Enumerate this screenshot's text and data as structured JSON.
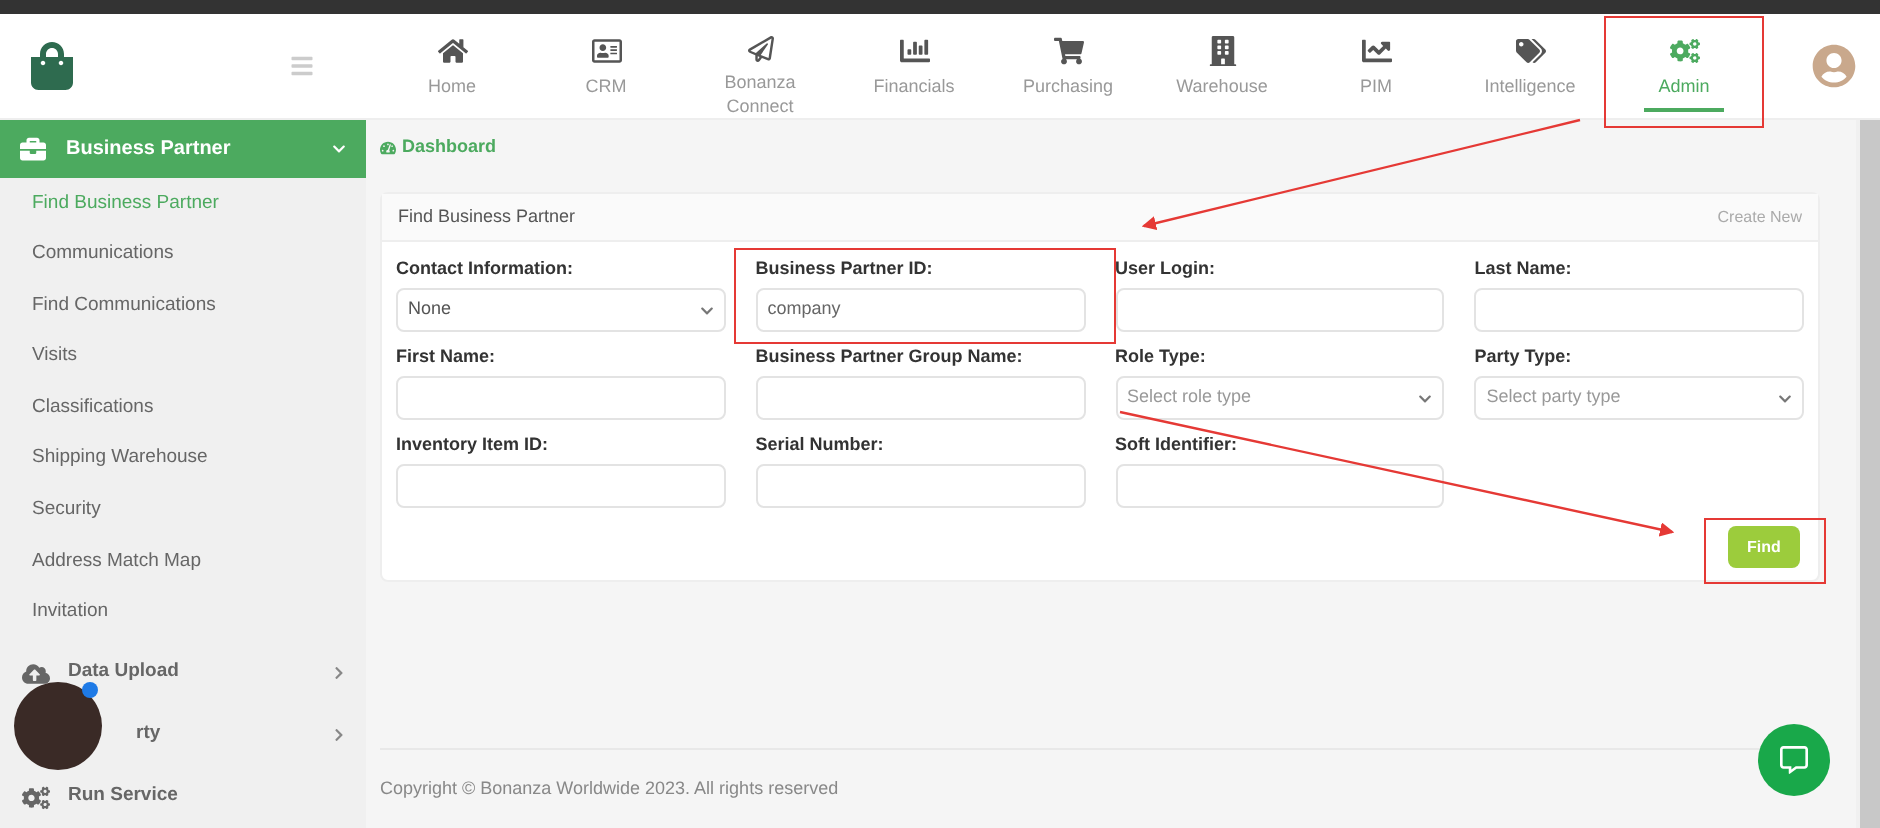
{
  "nav": [
    {
      "label": "Home",
      "selected": false
    },
    {
      "label": "CRM",
      "selected": false
    },
    {
      "label": "Bonanza Connect",
      "selected": false
    },
    {
      "label": "Financials",
      "selected": false
    },
    {
      "label": "Purchasing",
      "selected": false
    },
    {
      "label": "Warehouse",
      "selected": false
    },
    {
      "label": "PIM",
      "selected": false
    },
    {
      "label": "Intelligence",
      "selected": false
    },
    {
      "label": "Admin",
      "selected": true
    }
  ],
  "sidebar": {
    "section": {
      "label": "Business Partner",
      "expanded": true
    },
    "items": [
      {
        "label": "Find Business Partner",
        "selected": true
      },
      {
        "label": "Communications",
        "selected": false
      },
      {
        "label": "Find Communications",
        "selected": false
      },
      {
        "label": "Visits",
        "selected": false
      },
      {
        "label": "Classifications",
        "selected": false
      },
      {
        "label": "Shipping Warehouse",
        "selected": false
      },
      {
        "label": "Security",
        "selected": false
      },
      {
        "label": "Address Match Map",
        "selected": false
      },
      {
        "label": "Invitation",
        "selected": false
      }
    ],
    "groups": [
      {
        "label": "Data Upload",
        "expandable": true
      },
      {
        "label": "rty",
        "expandable": true
      },
      {
        "label": "Run Service",
        "expandable": false
      }
    ]
  },
  "breadcrumb": "Dashboard",
  "card": {
    "title": "Find Business Partner",
    "action": "Create New",
    "fields": [
      {
        "label": "Contact Information:",
        "kind": "select",
        "value": "None"
      },
      {
        "label": "Business Partner ID:",
        "kind": "text",
        "value": "company"
      },
      {
        "label": "User Login:",
        "kind": "text"
      },
      {
        "label": "Last Name:",
        "kind": "text"
      },
      {
        "label": "First Name:",
        "kind": "text"
      },
      {
        "label": "Business Partner Group Name:",
        "kind": "text"
      },
      {
        "label": "Role Type:",
        "kind": "select",
        "placeholder": "Select role type"
      },
      {
        "label": "Party Type:",
        "kind": "select",
        "placeholder": "Select party type"
      },
      {
        "label": "Inventory Item ID:",
        "kind": "text"
      },
      {
        "label": "Serial Number:",
        "kind": "text"
      },
      {
        "label": "Soft Identifier:",
        "kind": "text"
      }
    ],
    "button": "Find"
  },
  "footer": "Copyright © Bonanza Worldwide 2023. All rights reserved"
}
